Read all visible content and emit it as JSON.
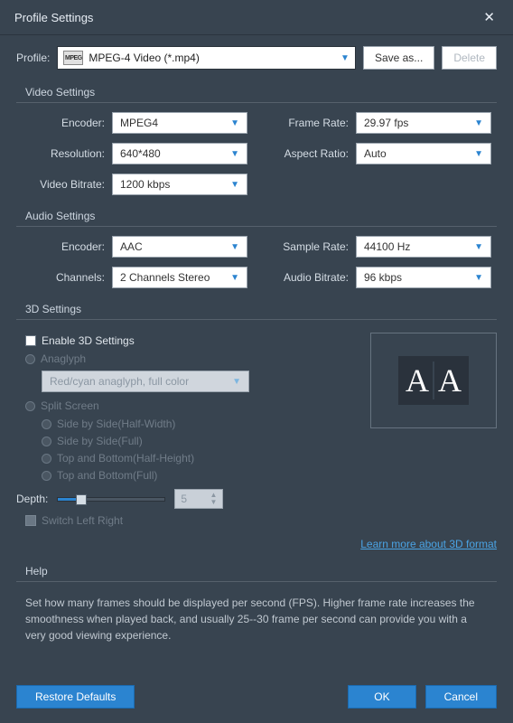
{
  "title": "Profile Settings",
  "profile": {
    "label": "Profile:",
    "icon_text": "MPEG",
    "value": "MPEG-4 Video (*.mp4)",
    "save_as": "Save as...",
    "delete": "Delete"
  },
  "video": {
    "title": "Video Settings",
    "encoder_label": "Encoder:",
    "encoder": "MPEG4",
    "framerate_label": "Frame Rate:",
    "framerate": "29.97 fps",
    "resolution_label": "Resolution:",
    "resolution": "640*480",
    "aspect_label": "Aspect Ratio:",
    "aspect": "Auto",
    "bitrate_label": "Video Bitrate:",
    "bitrate": "1200 kbps"
  },
  "audio": {
    "title": "Audio Settings",
    "encoder_label": "Encoder:",
    "encoder": "AAC",
    "samplerate_label": "Sample Rate:",
    "samplerate": "44100 Hz",
    "channels_label": "Channels:",
    "channels": "2 Channels Stereo",
    "bitrate_label": "Audio Bitrate:",
    "bitrate": "96 kbps"
  },
  "three_d": {
    "title": "3D Settings",
    "enable": "Enable 3D Settings",
    "anaglyph": "Anaglyph",
    "anaglyph_value": "Red/cyan anaglyph, full color",
    "split": "Split Screen",
    "opts": [
      "Side by Side(Half-Width)",
      "Side by Side(Full)",
      "Top and Bottom(Half-Height)",
      "Top and Bottom(Full)"
    ],
    "depth_label": "Depth:",
    "depth_value": "5",
    "switch": "Switch Left Right",
    "link": "Learn more about 3D format",
    "preview_a": "A",
    "preview_b": "A"
  },
  "help": {
    "title": "Help",
    "text": "Set how many frames should be displayed per second (FPS). Higher frame rate increases the smoothness when played back, and usually 25--30 frame per second can provide you with a very good viewing experience."
  },
  "footer": {
    "restore": "Restore Defaults",
    "ok": "OK",
    "cancel": "Cancel"
  }
}
